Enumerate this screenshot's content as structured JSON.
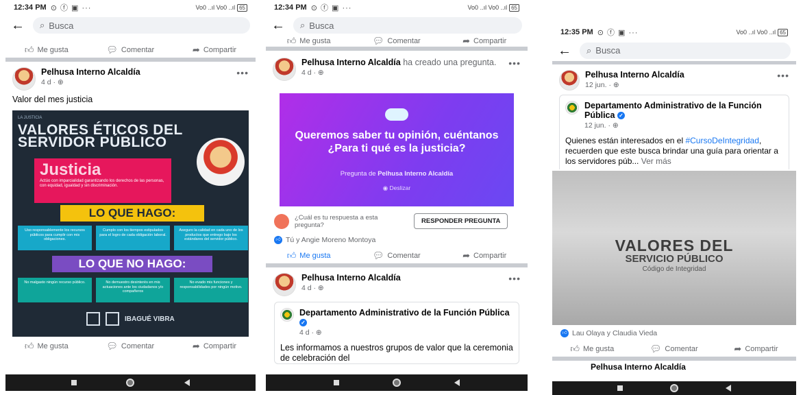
{
  "phone1": {
    "status": {
      "time": "12:34 PM",
      "icons": "⊙ ⓕ ▣ ···",
      "signal": "Vo0 ..ıl Vo0 ..ıl",
      "battery": "65"
    },
    "search": {
      "placeholder": "Busca"
    },
    "top_actions": {
      "like": "Me gusta",
      "comment": "Comentar",
      "share": "Compartir"
    },
    "post": {
      "page_name": "Pelhusa Interno Alcaldía",
      "meta": "4 d · ⊕",
      "text": "Valor del mes justicia",
      "poster": {
        "eyebrow": "LA JUSTICIA",
        "title": "VALORES ÉTICOS DEL SERVIDOR PÚBLICO",
        "justicia": "Justicia",
        "justicia_desc": "Actúo con imparcialidad garantizando los derechos de las personas, con equidad, igualdad y sin discriminación.",
        "hago": "LO QUE HAGO:",
        "hago_items": [
          "Uso responsablemente los recursos públicos para cumplir con mis obligaciones.",
          "Cumplo con los tiempos estipulados para el logro de cada obligación laboral.",
          "Aseguro la calidad en cada uno de los productos que entrego bajo los estándares del servidor público."
        ],
        "no_hago": "LO QUE NO HAGO:",
        "no_hago_items": [
          "No malgasto ningún recurso público.",
          "No demuestro desinterés en mis actuaciones ante los ciudadanos y/o compañeros",
          "No evado mis funciones y responsabilidades por ningún motivo."
        ],
        "logo_text": "IBAGUÉ VIBRA"
      }
    },
    "bottom_actions": {
      "like": "Me gusta",
      "comment": "Comentar",
      "share": "Compartir"
    }
  },
  "phone2": {
    "status": {
      "time": "12:34 PM",
      "icons": "⊙ ⓕ ▣ ···",
      "signal": "Vo0 ..ıl Vo0 ..ıl",
      "battery": "65"
    },
    "search": {
      "placeholder": "Busca"
    },
    "top_actions": {
      "like": "Me gusta",
      "comment": "Comentar",
      "share": "Compartir"
    },
    "post": {
      "page_name": "Pelhusa Interno Alcaldía",
      "action_text": "ha creado una pregunta.",
      "meta": "4 d · ⊕",
      "question": "Queremos saber tu opinión, cuéntanos ¿Para ti qué es la justicia?",
      "question_by_prefix": "Pregunta de",
      "question_by": "Pelhusa Interno Alcaldía",
      "swipe": "Deslizar",
      "answer_prompt": "¿Cuál es tu respuesta a esta pregunta?",
      "answer_button": "RESPONDER PREGUNTA",
      "reactions": "Tú y Angie Moreno Montoya"
    },
    "post_actions": {
      "like": "Me gusta",
      "comment": "Comentar",
      "share": "Compartir"
    },
    "post2": {
      "page_name": "Pelhusa Interno Alcaldía",
      "meta": "4 d · ⊕",
      "shared_name": "Departamento Administrativo de la Función Pública",
      "shared_meta": "4 d · ⊕",
      "shared_text": "Les informamos a nuestros grupos de valor que la ceremonia de celebración del"
    }
  },
  "phone3": {
    "status": {
      "time": "12:35 PM",
      "icons": "⊙ ⓕ ▣ ···",
      "signal": "Vo0 ..ıl Vo0 ..ıl",
      "battery": "65"
    },
    "search": {
      "placeholder": "Busca"
    },
    "post": {
      "page_name": "Pelhusa Interno Alcaldía",
      "meta": "12 jun. · ⊕",
      "shared_name": "Departamento Administrativo de la Función Pública",
      "shared_meta": "12 jun. · ⊕",
      "text_before": "Quienes están interesados en el",
      "hashtag": "#CursoDeIntegridad",
      "text_after": ", recuerden que este busca brindar una guía para orientar a los servidores púb...",
      "see_more": "Ver más",
      "photo_title": "VALORES DEL",
      "photo_subtitle": "SERVICIO PÚBLICO",
      "photo_caption": "Código de Integridad",
      "reactions": "Lau Olaya y Claudia Vieda"
    },
    "post_actions": {
      "like": "Me gusta",
      "comment": "Comentar",
      "share": "Compartir"
    },
    "next_post_name": "Pelhusa Interno Alcaldía"
  }
}
